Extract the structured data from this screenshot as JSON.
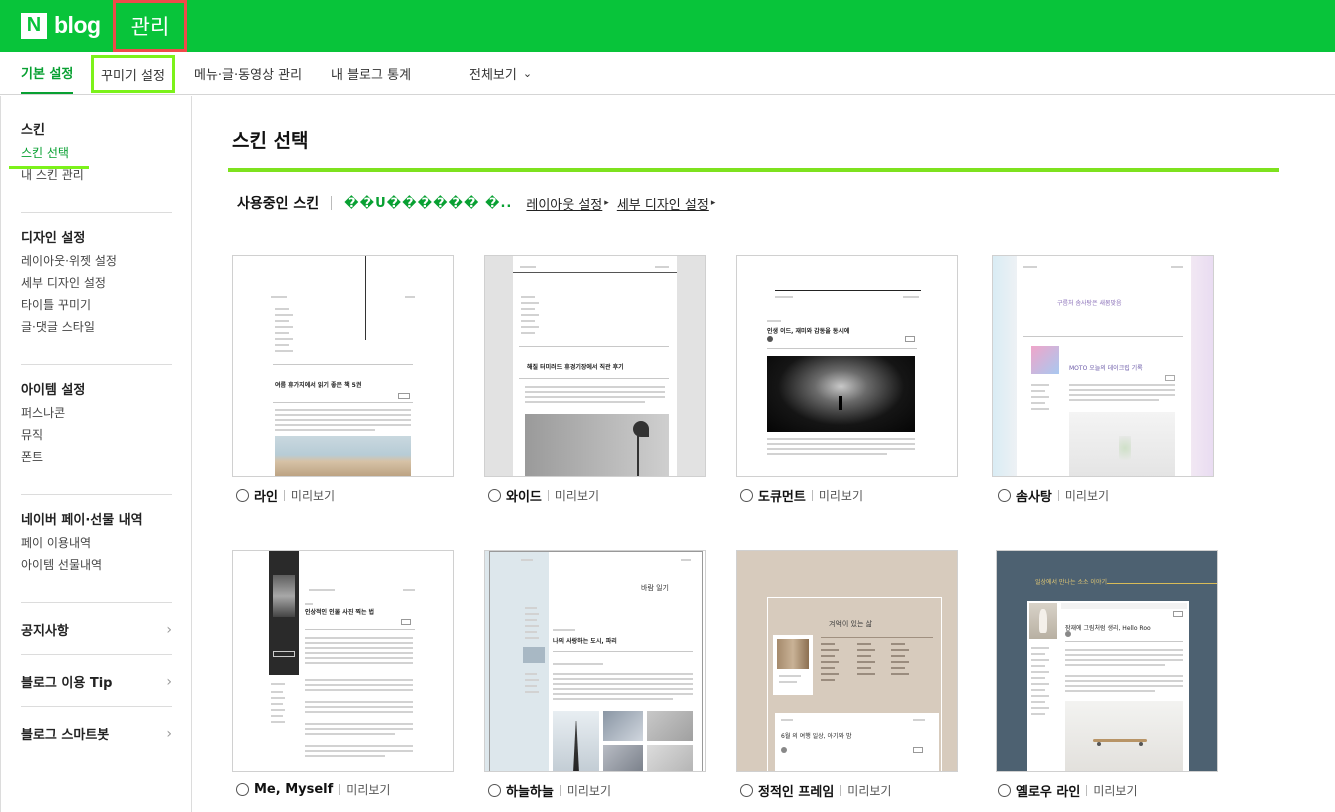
{
  "header": {
    "logo_n": "N",
    "logo_text": "blog",
    "manage_label": "관리"
  },
  "tabs": [
    {
      "label": "기본 설정"
    },
    {
      "label": "꾸미기 설정"
    },
    {
      "label": "메뉴·글·동영상 관리"
    },
    {
      "label": "내 블로그 통계"
    },
    {
      "label": "전체보기"
    }
  ],
  "sidebar": {
    "skin": {
      "title": "스킨",
      "items": [
        "스킨 선택",
        "내 스킨 관리"
      ]
    },
    "design": {
      "title": "디자인 설정",
      "items": [
        "레이아웃·위젯 설정",
        "세부 디자인 설정",
        "타이틀 꾸미기",
        "글·댓글 스타일"
      ]
    },
    "item": {
      "title": "아이템 설정",
      "items": [
        "퍼스나콘",
        "뮤직",
        "폰트"
      ]
    },
    "pay": {
      "title": "네이버 페이·선물 내역",
      "items": [
        "페이 이용내역",
        "아이템 선물내역"
      ]
    },
    "links": [
      "공지사항",
      "블로그 이용 Tip",
      "블로그 스마트봇"
    ]
  },
  "main": {
    "title": "스킨 선택",
    "using_label": "사용중인 스킨",
    "current_skin": "��U������ �..",
    "layout_link": "레이아웃 설정",
    "detail_link": "세부 디자인 설정"
  },
  "skins": [
    {
      "name": "라인",
      "preview": "미리보기"
    },
    {
      "name": "와이드",
      "preview": "미리보기"
    },
    {
      "name": "도큐먼트",
      "preview": "미리보기"
    },
    {
      "name": "솜사탕",
      "preview": "미리보기"
    },
    {
      "name": "Me, Myself",
      "preview": "미리보기"
    },
    {
      "name": "하늘하늘",
      "preview": "미리보기"
    },
    {
      "name": "정적인 프레임",
      "preview": "미리보기"
    },
    {
      "name": "옐로우 라인",
      "preview": "미리보기"
    }
  ],
  "thumbs": {
    "line_title": "여름 휴가지에서 읽기 좋은 책 5권",
    "wide_title": "해질 터미러드 휴경기장에서 직관 후기",
    "doc_title": "인생 이드, 재미와 감동을 동시에",
    "cotton_head": "구름처 솜사탕은 새봄맞음",
    "cotton_title": "MOTO 오늘의 데이크립 기록",
    "me_title": "인상적인 인물 사진 찍는 법",
    "sky_head": "바람 일기",
    "sky_title": "나의 사랑하는 도시, 파리",
    "frame_head": "겨억이 있는 삶",
    "frame_title": "6월 의 여행 일상, 아기와 밤",
    "yellow_head": "일상에서 만나는 소소 이야기",
    "yellow_title": "잠재에 그림처럼 생리, Hello Roo"
  },
  "colors": {
    "brand_green": "#08c43a",
    "active_green": "#08a032",
    "highlight_green": "#7cf21a",
    "highlight_red": "#f04a4a"
  }
}
